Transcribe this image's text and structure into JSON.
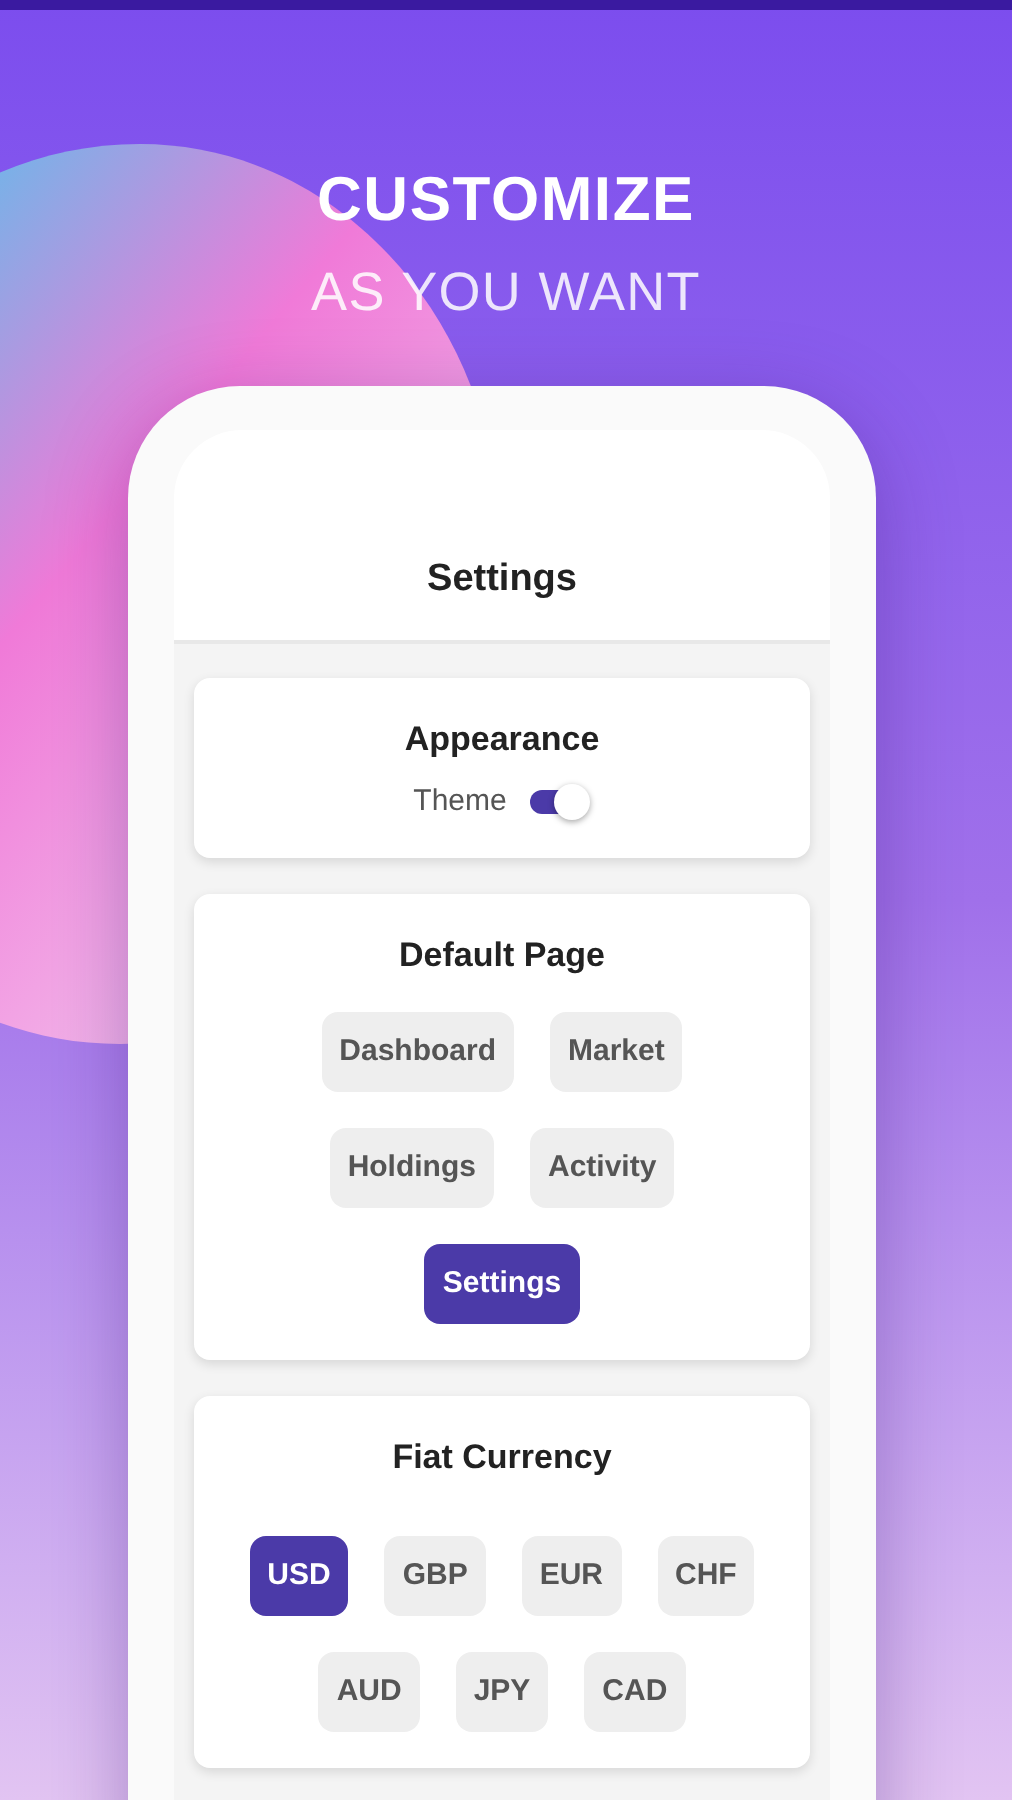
{
  "headline": {
    "title": "CUSTOMIZE",
    "subtitle": "AS YOU WANT"
  },
  "screen": {
    "title": "Settings",
    "appearance": {
      "title": "Appearance",
      "theme": {
        "label": "Theme",
        "on": true
      }
    },
    "default_page": {
      "title": "Default Page",
      "rows": [
        {
          "options": [
            {
              "label": "Dashboard",
              "selected": false
            },
            {
              "label": "Market",
              "selected": false
            }
          ]
        },
        {
          "options": [
            {
              "label": "Holdings",
              "selected": false
            },
            {
              "label": "Activity",
              "selected": false
            }
          ]
        },
        {
          "options": [
            {
              "label": "Settings",
              "selected": true
            }
          ]
        }
      ]
    },
    "fiat_currency": {
      "title": "Fiat Currency",
      "rows": [
        {
          "options": [
            {
              "label": "USD",
              "selected": true
            },
            {
              "label": "GBP",
              "selected": false
            },
            {
              "label": "EUR",
              "selected": false
            },
            {
              "label": "CHF",
              "selected": false
            }
          ]
        },
        {
          "options": [
            {
              "label": "AUD",
              "selected": false
            },
            {
              "label": "JPY",
              "selected": false
            },
            {
              "label": "CAD",
              "selected": false
            }
          ]
        }
      ]
    }
  }
}
